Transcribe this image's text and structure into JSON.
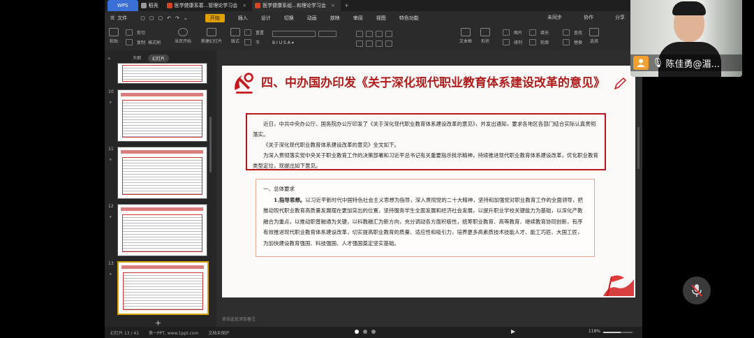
{
  "titlebar": {
    "app_tab": "WPS",
    "tabs": [
      {
        "label": "稻壳",
        "icon": "docer-icon"
      },
      {
        "label": "医学健康系葛...管理论学习会",
        "icon": "ppt-icon"
      },
      {
        "label": "医学健康系组...和理论学习会",
        "icon": "ppt-icon"
      }
    ]
  },
  "menu": {
    "file": "文件",
    "items": [
      "开始",
      "插入",
      "设计",
      "切换",
      "动画",
      "放映",
      "审阅",
      "视图",
      "特色功能"
    ],
    "right": [
      "未同步",
      "协作",
      "分享"
    ]
  },
  "toolbar": {
    "paste": "粘贴",
    "cut": "剪切",
    "copy": "复制",
    "format_painter": "格式刷",
    "play_from_current": "当页开始",
    "new_slide": "新建幻灯片",
    "layout": "版式",
    "section": "节",
    "reset": "重置",
    "textbox": "文本框",
    "shape": "形状",
    "arrange": "排列",
    "outline": "轮廓",
    "find": "查找",
    "replace": "替换",
    "select": "选择",
    "picture": "图片",
    "fill": "填充"
  },
  "left_panel": {
    "view_tabs": [
      "大纲",
      "幻灯片"
    ],
    "slides": [
      {
        "num": "10"
      },
      {
        "num": "11"
      },
      {
        "num": "12"
      },
      {
        "num": "13",
        "selected": true
      }
    ]
  },
  "slide": {
    "title": "四、中办国办印发《关于深化现代职业教育体系建设改革的意见》",
    "box1": [
      "近日，中共中央办公厅、国务院办公厅印发了《关于深化现代职业教育体系建设改革的意见》，并发出通知，要求各地区各部门结合实际认真贯彻落实。",
      "《关于深化现代职业教育体系建设改革的意见》全文如下。",
      "为深入贯彻落实党中央关于职业教育工作的决策部署和习近平总书记有关重要指示批示精神，持续推进现代职业教育体系建设改革，优化职业教育类型定位，现提出如下意见。"
    ],
    "section_heading": "一、总体要求",
    "lead": "1.指导思想。",
    "body": "以习近平新时代中国特色社会主义思想为指导，深入贯彻党的二十大精神，坚持和加强党对职业教育工作的全面领导，把推动现代职业教育高质量发展摆在更加突出的位置，坚持服务学生全面发展和经济社会发展，以提升职业学校关键能力为基础，以深化产教融合为重点，以推动职普融通为关键，以科教融汇为新方向，充分调动各方面积极性，统筹职业教育、高等教育、继续教育协同创新，有序有效推进现代职业教育体系建设改革，切实提高职业教育的质量、适应性和吸引力，培养更多高素质技术技能人才、能工巧匠、大国工匠，为加快建设教育强国、科技强国、人才强国奠定坚实基础。"
  },
  "note_placeholder": "单击此处添加备注",
  "status": {
    "slide_count": "幻灯片 13 / 41",
    "theme": "第一PPT, www.1ppt.com",
    "protect": "文档未保护",
    "zoom": "118%",
    "zoom_fraction": 0.6
  },
  "video_call": {
    "name": "陈佳勇@湄...",
    "mic_state": "muted"
  },
  "colors": {
    "title_red": "#b01b1b",
    "accent_orange": "#f0a030",
    "start_tab": "#e0a100"
  }
}
